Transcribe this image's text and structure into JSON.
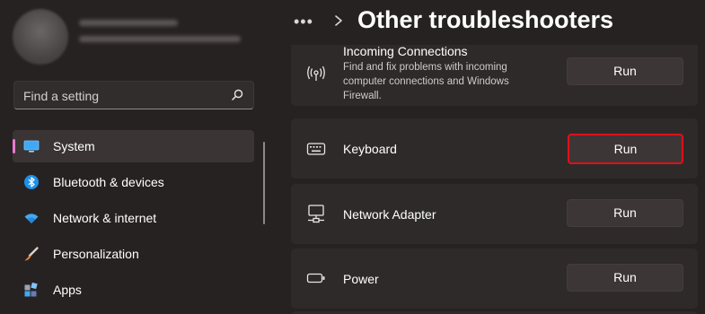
{
  "user": {
    "name": "",
    "email": ""
  },
  "search": {
    "placeholder": "Find a setting"
  },
  "sidebar": {
    "items": [
      {
        "label": "System",
        "icon": "monitor-icon",
        "selected": true
      },
      {
        "label": "Bluetooth & devices",
        "icon": "bluetooth-icon"
      },
      {
        "label": "Network & internet",
        "icon": "wifi-icon"
      },
      {
        "label": "Personalization",
        "icon": "brush-icon"
      },
      {
        "label": "Apps",
        "icon": "apps-icon"
      }
    ]
  },
  "header": {
    "more": "•••",
    "title": "Other troubleshooters"
  },
  "troubleshooters": [
    {
      "title": "Incoming Connections",
      "description": "Find and fix problems with incoming computer connections and Windows Firewall.",
      "button": "Run",
      "icon": "incoming-connections-icon"
    },
    {
      "title": "Keyboard",
      "button": "Run",
      "icon": "keyboard-icon",
      "highlighted": true
    },
    {
      "title": "Network Adapter",
      "button": "Run",
      "icon": "network-adapter-icon"
    },
    {
      "title": "Power",
      "button": "Run",
      "icon": "battery-icon"
    }
  ],
  "colors": {
    "background": "#272222",
    "card": "#2f2a2a",
    "button": "#3c3636",
    "accent": "#e879d0",
    "highlight_border": "#e0101a"
  }
}
